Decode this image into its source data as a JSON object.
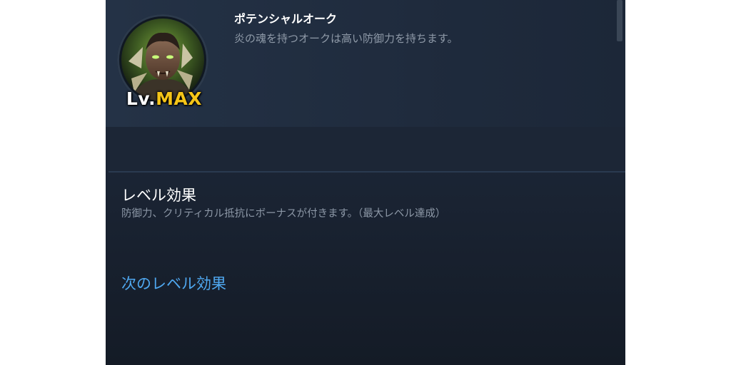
{
  "character": {
    "name": "ポテンシャルオーク",
    "description": "炎の魂を持つオークは高い防御力を持ちます。",
    "level_prefix": "Lv.",
    "level_value": "MAX",
    "avatar_icon": "orc-portrait-icon"
  },
  "level_effect": {
    "title": "レベル効果",
    "description": "防御力、クリティカル抵抗にボーナスが付きます。（最大レベル達成）"
  },
  "next_level_effect": {
    "title": "次のレベル効果"
  },
  "colors": {
    "accent_link": "#4fa8f0",
    "level_gold": "#f5c518",
    "panel_bg": "#1e2a3a"
  }
}
